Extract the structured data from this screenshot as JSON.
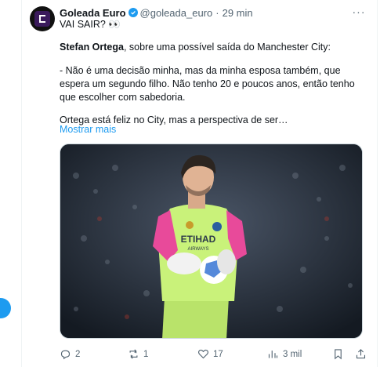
{
  "tweet": {
    "author_name": "Goleada Euro",
    "handle": "@goleada_euro",
    "separator": "·",
    "time": "29 min",
    "line1": "VAI SAIR? 👀",
    "speaker": "Stefan Ortega",
    "speaker_rest": ", sobre uma possível saída do Manchester City:",
    "quote": "- Não é uma decisão minha, mas da minha esposa também, que espera um segundo filho. Não tenho 20 e poucos anos, então tenho que escolher com sabedoria.",
    "line4": "Ortega está feliz no City, mas a perspectiva de ser…",
    "show_more": "Mostrar mais"
  },
  "media": {
    "description_icon": "goalkeeper-photo",
    "shirt_sponsor": "ETIHAD",
    "shirt_sponsor_sub": "AIRWAYS",
    "kit_color": "#c9f27a",
    "glove_color": "#e84a9a"
  },
  "actions": {
    "replies": "2",
    "reposts": "1",
    "likes": "17",
    "views": "3 mil"
  },
  "colors": {
    "accent": "#1d9bf0",
    "muted": "#536471"
  }
}
